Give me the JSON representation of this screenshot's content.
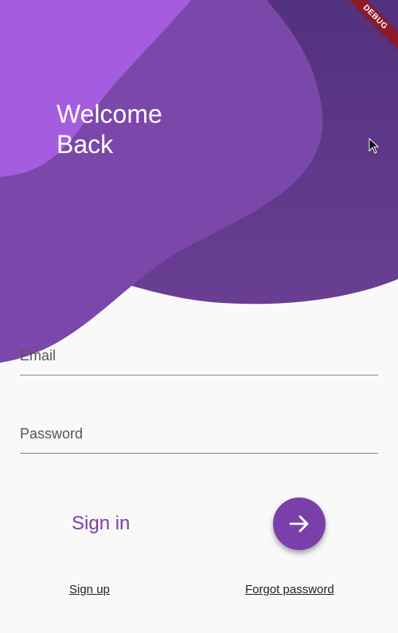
{
  "header": {
    "title_line1": "Welcome",
    "title_line2": "Back"
  },
  "form": {
    "email_label": "Email",
    "email_value": "",
    "password_label": "Password",
    "password_value": ""
  },
  "actions": {
    "signin_label": "Sign in",
    "submit_icon": "arrow-right-icon"
  },
  "links": {
    "signup": "Sign up",
    "forgot_password": "Forgot password"
  },
  "debug_banner": "DEBUG",
  "colors": {
    "accent": "#7a3fa8",
    "wave_light": "#a45ce0",
    "wave_mid": "#7e48ac",
    "wave_dark": "#5d3789",
    "background": "#f9f9f9",
    "debug_banner": "#8b1a2a"
  }
}
